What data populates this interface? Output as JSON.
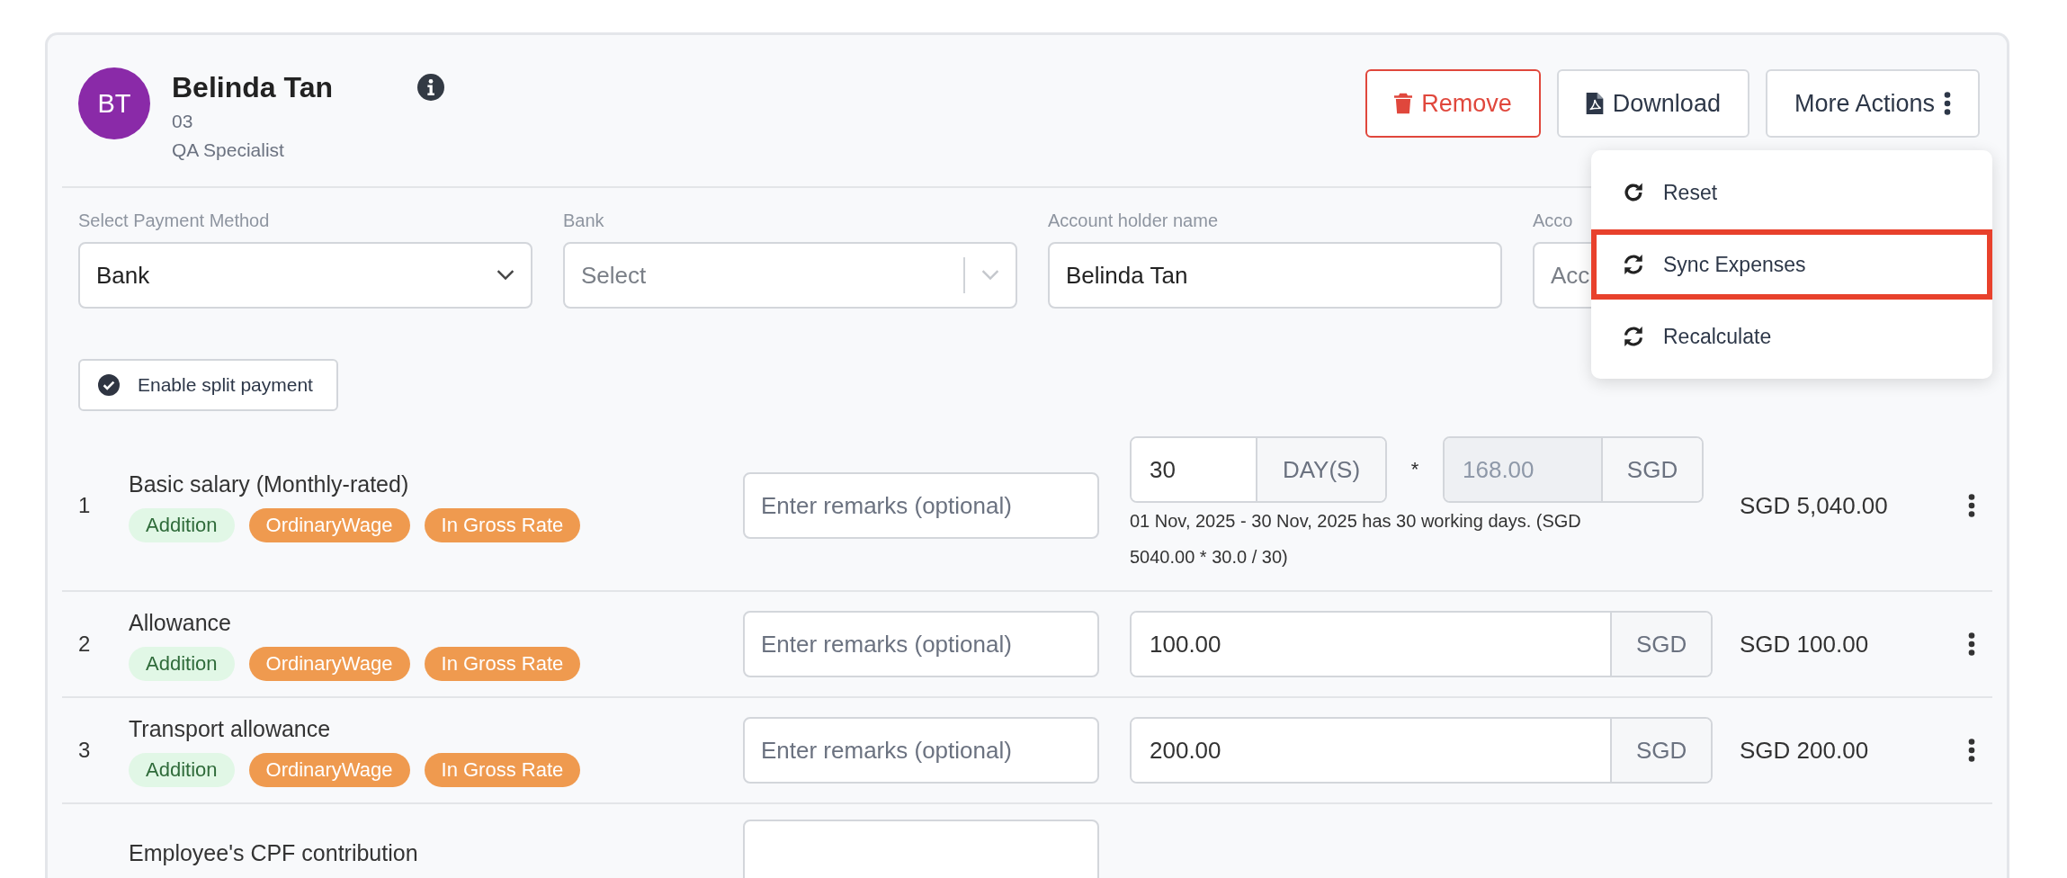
{
  "employee": {
    "initials": "BT",
    "name": "Belinda Tan",
    "id": "03",
    "position": "QA Specialist"
  },
  "actions": [
    {
      "label": "Remove",
      "kind": "danger"
    },
    {
      "label": "Download",
      "kind": "download"
    },
    {
      "label": "More Actions",
      "kind": "more"
    }
  ],
  "menu": {
    "items": [
      {
        "label": "Reset",
        "kind": "reset",
        "highlighted": false
      },
      {
        "label": "Sync Expenses",
        "kind": "sync",
        "highlighted": true
      },
      {
        "label": "Recalculate",
        "kind": "sync",
        "highlighted": false
      }
    ]
  },
  "payment_fields": [
    {
      "label": "Select Payment Method",
      "kind": "select",
      "value": "Bank"
    },
    {
      "label": "Bank",
      "kind": "select-clear",
      "placeholder": "Select"
    },
    {
      "label": "Account holder name",
      "kind": "text",
      "value": "Belinda Tan"
    },
    {
      "label": "Acco",
      "kind": "text",
      "placeholder": "Acc"
    }
  ],
  "split_payment": {
    "label": "Enable split payment",
    "checked": true
  },
  "rows": [
    {
      "kind": "rate",
      "index": "1",
      "title": "Basic salary (Monthly-rated)",
      "tags": [
        {
          "label": "Addition",
          "kind": "type"
        },
        {
          "label": "OrdinaryWage",
          "kind": "wage"
        },
        {
          "label": "In Gross Rate",
          "kind": "wage"
        }
      ],
      "remarks_placeholder": "Enter remarks (optional)",
      "quantity": "30",
      "unit": "DAY(S)",
      "operator": "*",
      "rate": "168.00",
      "currency": "SGD",
      "note": "01 Nov, 2025 - 30 Nov, 2025 has 30 working days. (SGD 5040.00 * 30.0 / 30)",
      "total": "SGD 5,040.00"
    },
    {
      "kind": "amount",
      "index": "2",
      "title": "Allowance",
      "tags": [
        {
          "label": "Addition",
          "kind": "type"
        },
        {
          "label": "OrdinaryWage",
          "kind": "wage"
        },
        {
          "label": "In Gross Rate",
          "kind": "wage"
        }
      ],
      "remarks_placeholder": "Enter remarks (optional)",
      "amount": "100.00",
      "currency": "SGD",
      "total": "SGD 100.00"
    },
    {
      "kind": "amount",
      "index": "3",
      "title": "Transport allowance",
      "tags": [
        {
          "label": "Addition",
          "kind": "type"
        },
        {
          "label": "OrdinaryWage",
          "kind": "wage"
        },
        {
          "label": "In Gross Rate",
          "kind": "wage"
        }
      ],
      "remarks_placeholder": "Enter remarks (optional)",
      "amount": "200.00",
      "currency": "SGD",
      "total": "SGD 200.00"
    },
    {
      "kind": "partial",
      "title": "Employee's CPF contribution"
    }
  ]
}
